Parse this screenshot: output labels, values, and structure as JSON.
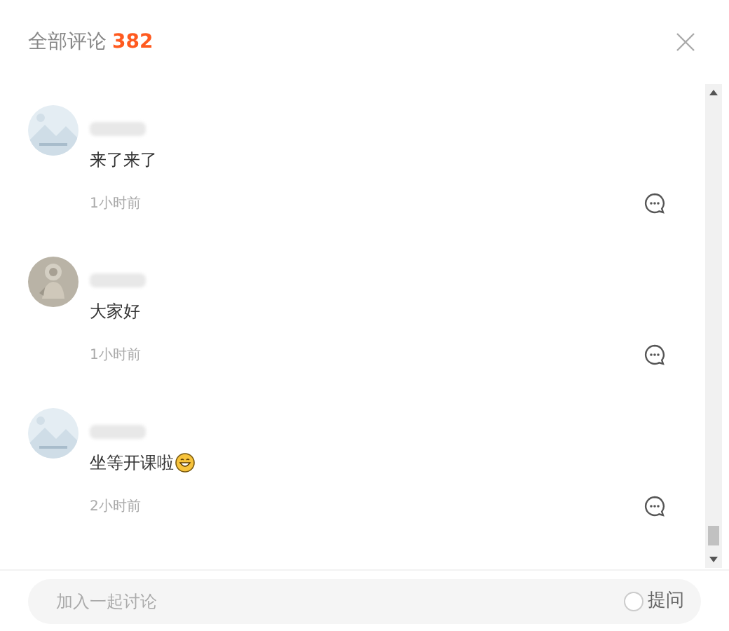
{
  "header": {
    "title": "全部评论",
    "count": "382"
  },
  "comments": [
    {
      "text": "来了来了",
      "emoji": false,
      "time": "1小时前"
    },
    {
      "text": "大家好",
      "emoji": false,
      "time": "1小时前"
    },
    {
      "text": "坐等开课啦",
      "emoji": true,
      "time": "2小时前"
    }
  ],
  "composer": {
    "placeholder": "加入一起讨论",
    "question": {
      "label": "提问",
      "checked": false
    }
  }
}
